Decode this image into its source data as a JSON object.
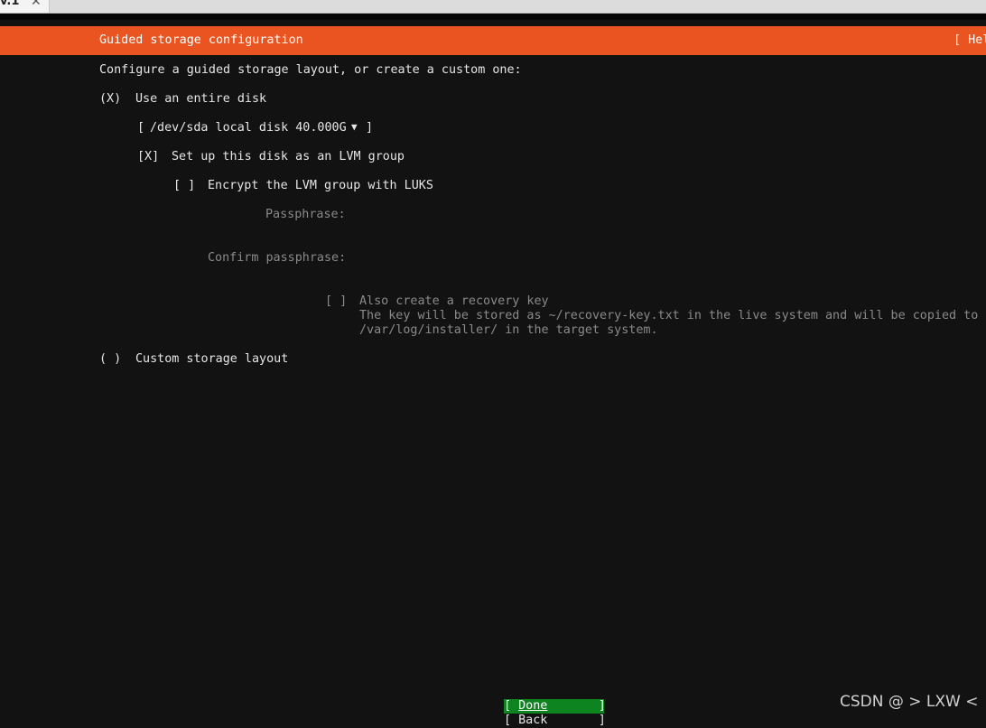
{
  "browser": {
    "tab_label": "v.1",
    "tab_close_icon": "✕"
  },
  "header": {
    "title": "Guided storage configuration",
    "help": "[ Help ]"
  },
  "intro": "Configure a guided storage layout, or create a custom one:",
  "entire_disk": {
    "radio": "(X)",
    "label": "Use an entire disk",
    "disk_select": {
      "open": "[",
      "value": "/dev/sda local disk 40.000G",
      "arrow": "▼",
      "close": "]"
    },
    "lvm": {
      "checkbox": "[X]",
      "label": "Set up this disk as an LVM group"
    },
    "luks": {
      "checkbox": "[ ]",
      "label": "Encrypt the LVM group with LUKS"
    },
    "passphrase_label": "Passphrase:",
    "confirm_label": "Confirm passphrase:",
    "recovery": {
      "checkbox": "[ ]",
      "label": "Also create a recovery key",
      "help_line1": "The key will be stored as ~/recovery-key.txt in the live system and will be copied to",
      "help_line2": "/var/log/installer/ in the target system."
    }
  },
  "custom": {
    "radio": "( )",
    "label": "Custom storage layout"
  },
  "buttons": {
    "done": {
      "open": "[ ",
      "label": "Done",
      "close": "       ]"
    },
    "back": {
      "open": "[ ",
      "label": "Back",
      "close": "       ]"
    }
  },
  "watermark": "CSDN @ > LXW <",
  "colors": {
    "header_bg": "#e95420",
    "done_bg": "#0e8420",
    "bg": "#121212"
  }
}
